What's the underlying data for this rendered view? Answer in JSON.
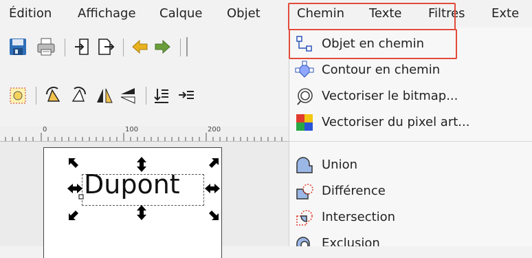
{
  "menubar": {
    "items": [
      "Édition",
      "Affichage",
      "Calque",
      "Objet",
      "Chemin",
      "Texte",
      "Filtres",
      "Exte"
    ]
  },
  "canvas": {
    "ruler_labels": [
      "0",
      "100",
      "200"
    ],
    "text_object": "Dupont"
  },
  "dropdown": {
    "items": [
      {
        "label": "Objet en chemin",
        "icon": "object-to-path-icon"
      },
      {
        "label": "Contour en chemin",
        "icon": "stroke-to-path-icon"
      },
      {
        "label": "Vectoriser le bitmap...",
        "icon": "trace-bitmap-icon"
      },
      {
        "label": "Vectoriser du pixel art...",
        "icon": "trace-pixel-art-icon"
      },
      {
        "label": "Union",
        "icon": "union-icon"
      },
      {
        "label": "Différence",
        "icon": "difference-icon"
      },
      {
        "label": "Intersection",
        "icon": "intersection-icon"
      },
      {
        "label": "Exclusion",
        "icon": "exclusion-icon"
      }
    ]
  },
  "colors": {
    "highlight": "#e24a3b",
    "save_blue": "#2f6fb7",
    "undo_yellow": "#e8b21e",
    "redo_green": "#6a9e3a"
  }
}
